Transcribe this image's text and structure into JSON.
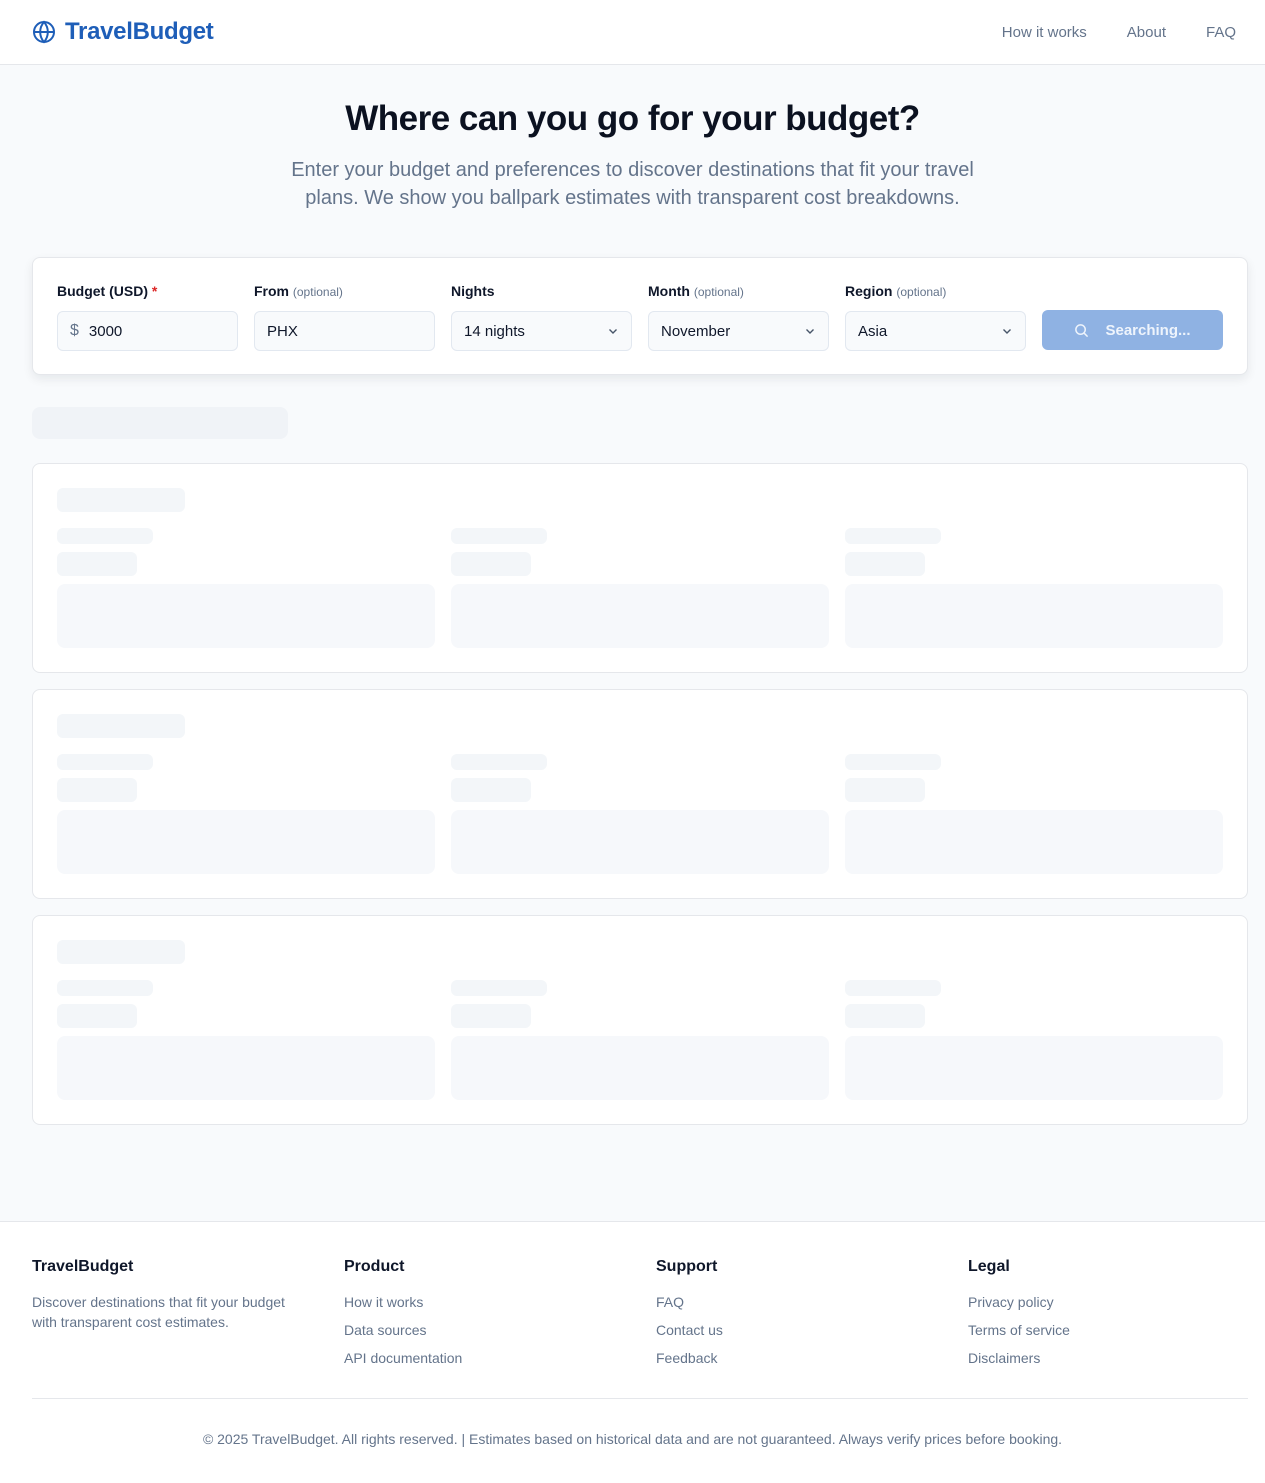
{
  "header": {
    "brand": "TravelBudget",
    "nav": [
      "How it works",
      "About",
      "FAQ"
    ],
    "brand_color": "#1e5eb8"
  },
  "hero": {
    "title": "Where can you go for your budget?",
    "subtitle": "Enter your budget and preferences to discover destinations that fit your travel plans. We show you ballpark estimates with transparent cost breakdowns."
  },
  "search": {
    "budget": {
      "label": "Budget (USD)",
      "required_mark": "*",
      "prefix": "$",
      "value": "3000"
    },
    "from": {
      "label": "From",
      "optional": "(optional)",
      "value": "PHX"
    },
    "nights": {
      "label": "Nights",
      "value": "14 nights"
    },
    "month": {
      "label": "Month",
      "optional": "(optional)",
      "value": "November"
    },
    "region": {
      "label": "Region",
      "optional": "(optional)",
      "value": "Asia"
    },
    "button": {
      "label": "Searching...",
      "state": "loading",
      "color": "#8fb2e3"
    }
  },
  "results": {
    "loading": true,
    "skeleton_cards": 3
  },
  "footer": {
    "brand": "TravelBudget",
    "tagline": "Discover destinations that fit your budget with transparent cost estimates.",
    "product": {
      "title": "Product",
      "links": [
        "How it works",
        "Data sources",
        "API documentation"
      ]
    },
    "support": {
      "title": "Support",
      "links": [
        "FAQ",
        "Contact us",
        "Feedback"
      ]
    },
    "legal": {
      "title": "Legal",
      "links": [
        "Privacy policy",
        "Terms of service",
        "Disclaimers"
      ]
    },
    "copyright": "© 2025 TravelBudget. All rights reserved. | Estimates based on historical data and are not guaranteed. Always verify prices before booking."
  }
}
